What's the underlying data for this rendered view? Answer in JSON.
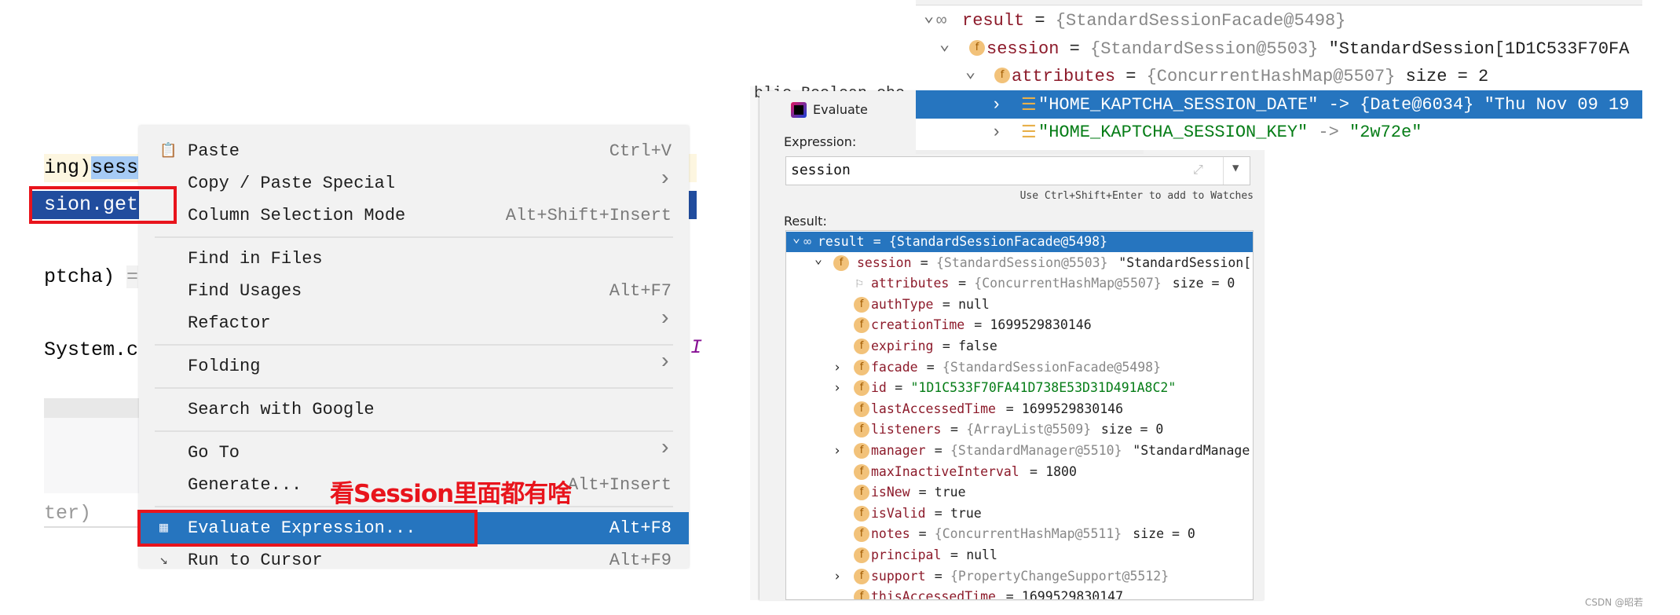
{
  "editor": {
    "line1a": "ing)",
    "line1b": "sess",
    "line2": "sion.get",
    "line3": "ptcha)",
    "line3b": "=",
    "line4": "System.c",
    "line5": "ter)",
    "right1": "(",
    "right4": "I"
  },
  "annotation": "看Session里面都有啥",
  "menu": {
    "items": [
      {
        "label": "Paste",
        "shortcut": "Ctrl+V",
        "icon": "clipboard-icon",
        "submenu": false
      },
      {
        "label": "Copy / Paste Special",
        "shortcut": "",
        "submenu": true
      },
      {
        "label": "Column Selection Mode",
        "shortcut": "Alt+Shift+Insert",
        "submenu": false
      },
      {
        "label": "Find in Files",
        "shortcut": "",
        "submenu": false,
        "sep_before": true
      },
      {
        "label": "Find Usages",
        "shortcut": "Alt+F7",
        "submenu": false
      },
      {
        "label": "Refactor",
        "shortcut": "",
        "submenu": true
      },
      {
        "label": "Folding",
        "shortcut": "",
        "submenu": true,
        "sep_before": true
      },
      {
        "label": "Search with Google",
        "shortcut": "",
        "submenu": false,
        "sep_before": true
      },
      {
        "label": "Go To",
        "shortcut": "",
        "submenu": true,
        "sep_before": true
      },
      {
        "label": "Generate...",
        "shortcut": "Alt+Insert",
        "submenu": false
      },
      {
        "label": "Evaluate Expression...",
        "shortcut": "Alt+F8",
        "icon": "calculator-icon",
        "submenu": false,
        "selected": true,
        "sep_before": true
      },
      {
        "label": "Run to Cursor",
        "shortcut": "Alt+F9",
        "icon": "run-to-cursor-icon",
        "submenu": false
      }
    ]
  },
  "dialog": {
    "title": "Evaluate",
    "expression_label": "Expression:",
    "expression": "session",
    "hint": "Use Ctrl+Shift+Enter to add to Watches",
    "result_label": "Result:",
    "behind_text": "blic Boolean che",
    "rows": [
      {
        "exp": "v",
        "icon": "oo",
        "name": "result",
        "type": "{StandardSessionFacade@5498}",
        "selected": true,
        "level": 0
      },
      {
        "exp": "v",
        "icon": "f",
        "name": "session",
        "type": "{StandardSession@5503}",
        "plain": "\"StandardSession[1",
        "level": 1
      },
      {
        "exp": "",
        "icon": "flag",
        "name": "attributes",
        "type": "{ConcurrentHashMap@5507}",
        "plain": "size = 0",
        "level": 2
      },
      {
        "exp": "",
        "icon": "f",
        "name": "authType",
        "plain": "null",
        "level": 2
      },
      {
        "exp": "",
        "icon": "f",
        "name": "creationTime",
        "plain": "1699529830146",
        "level": 2
      },
      {
        "exp": "",
        "icon": "f",
        "name": "expiring",
        "plain": "false",
        "level": 2
      },
      {
        "exp": ">",
        "icon": "f",
        "name": "facade",
        "type": "{StandardSessionFacade@5498}",
        "level": 2
      },
      {
        "exp": ">",
        "icon": "f",
        "name": "id",
        "str": "\"1D1C533F70FA41D738E53D31D491A8C2\"",
        "level": 2
      },
      {
        "exp": "",
        "icon": "f",
        "name": "lastAccessedTime",
        "plain": "1699529830146",
        "level": 2
      },
      {
        "exp": "",
        "icon": "f",
        "name": "listeners",
        "type": "{ArrayList@5509}",
        "plain": "size = 0",
        "level": 2
      },
      {
        "exp": ">",
        "icon": "f",
        "name": "manager",
        "type": "{StandardManager@5510}",
        "plain": "\"StandardManage",
        "level": 2
      },
      {
        "exp": "",
        "icon": "f",
        "name": "maxInactiveInterval",
        "plain": "1800",
        "level": 2
      },
      {
        "exp": "",
        "icon": "f",
        "name": "isNew",
        "plain": "true",
        "level": 2
      },
      {
        "exp": "",
        "icon": "f",
        "name": "isValid",
        "plain": "true",
        "level": 2
      },
      {
        "exp": "",
        "icon": "f",
        "name": "notes",
        "type": "{ConcurrentHashMap@5511}",
        "plain": "size = 0",
        "level": 2
      },
      {
        "exp": "",
        "icon": "f",
        "name": "principal",
        "plain": "null",
        "level": 2
      },
      {
        "exp": ">",
        "icon": "f",
        "name": "support",
        "type": "{PropertyChangeSupport@5512}",
        "level": 2
      },
      {
        "exp": "",
        "icon": "f",
        "name": "thisAccessedTime",
        "plain": "1699529830147",
        "level": 2
      }
    ]
  },
  "debugger": {
    "rows": [
      {
        "exp": "v",
        "icon": "oo",
        "name": "result",
        "type": "{StandardSessionFacade@5498}",
        "level": 0
      },
      {
        "exp": "v",
        "icon": "f",
        "name": "session",
        "type": "{StandardSession@5503}",
        "plain": "\"StandardSession[1D1C533F70FA",
        "level": 1
      },
      {
        "exp": "v",
        "icon": "f",
        "name": "attributes",
        "type": "{ConcurrentHashMap@5507}",
        "plain": "size = 2",
        "level": 2
      },
      {
        "exp": ">",
        "icon": "entry",
        "str": "\"HOME_KAPTCHA_SESSION_DATE\"",
        "arrow": "->",
        "type": "{Date@6034}",
        "plain": "\"Thu Nov 09 19",
        "level": 3,
        "selected": true
      },
      {
        "exp": ">",
        "icon": "entry",
        "str": "\"HOME_KAPTCHA_SESSION_KEY\"",
        "arrow": "->",
        "str2": "\"2w72e\"",
        "level": 3
      }
    ]
  },
  "watermark": "CSDN @昭若",
  "colors": {
    "selection": "#2675bf",
    "annotation_red": "#e8141c",
    "field_name": "#8c1a2a",
    "string": "#067d17"
  }
}
